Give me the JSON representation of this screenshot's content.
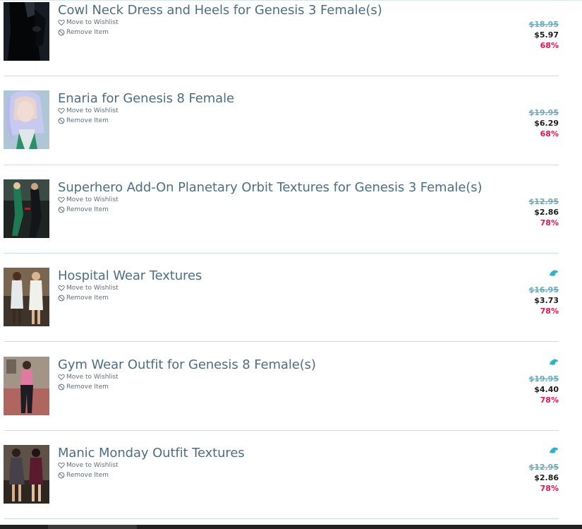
{
  "cart": {
    "items": [
      {
        "title": "Cowl Neck Dress and Heels for Genesis 3 Female(s)",
        "wishlist_label": "Move to Wishlist",
        "remove_label": "Remove Item",
        "original_price": "$18.95",
        "sale_price": "$5.97",
        "discount": "68%",
        "badge": "",
        "thumbnail": "dark-dress-figure"
      },
      {
        "title": "Enaria for Genesis 8 Female",
        "wishlist_label": "Move to Wishlist",
        "remove_label": "Remove Item",
        "original_price": "$19.95",
        "sale_price": "$6.29",
        "discount": "68%",
        "badge": "",
        "thumbnail": "silver-haired-character"
      },
      {
        "title": "Superhero Add-On Planetary Orbit Textures for Genesis 3 Female(s)",
        "wishlist_label": "Move to Wishlist",
        "remove_label": "Remove Item",
        "original_price": "$12.95",
        "sale_price": "$2.86",
        "discount": "78%",
        "badge": "",
        "thumbnail": "superhero-figures"
      },
      {
        "title": "Hospital Wear Textures",
        "wishlist_label": "Move to Wishlist",
        "remove_label": "Remove Item",
        "original_price": "$16.95",
        "sale_price": "$3.73",
        "discount": "78%",
        "badge": "dolphin-icon",
        "thumbnail": "hospital-wear-figures"
      },
      {
        "title": "Gym Wear Outfit for Genesis 8 Female(s)",
        "wishlist_label": "Move to Wishlist",
        "remove_label": "Remove Item",
        "original_price": "$19.95",
        "sale_price": "$4.40",
        "discount": "78%",
        "badge": "dolphin-icon",
        "thumbnail": "gym-wear-figure"
      },
      {
        "title": "Manic Monday Outfit Textures",
        "wishlist_label": "Move to Wishlist",
        "remove_label": "Remove Item",
        "original_price": "$12.95",
        "sale_price": "$2.86",
        "discount": "78%",
        "badge": "dolphin-icon",
        "thumbnail": "outfit-figures"
      }
    ]
  },
  "colors": {
    "title": "#4d6e84",
    "strikethrough_price": "#6aa9bd",
    "sale_price": "#1b1b1b",
    "discount": "#e5154f",
    "badge": "#2fb3c9",
    "divider": "#c9dde2"
  }
}
